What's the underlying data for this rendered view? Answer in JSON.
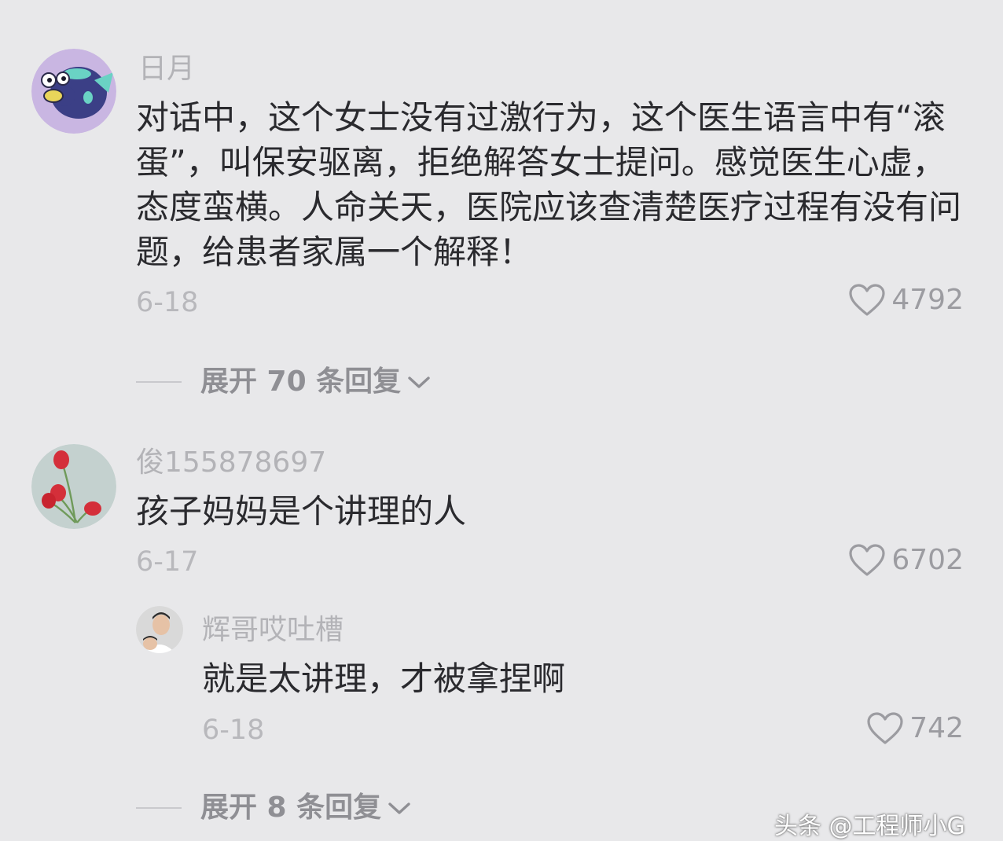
{
  "comments": [
    {
      "username": "日月",
      "text": "对话中，这个女士没有过激行为，这个医生语言中有“滚蛋”，叫保安驱离，拒绝解答女士提问。感觉医生心虚，态度蛮横。人命关天，医院应该查清楚医疗过程有没有问题，给患者家属一个解释！",
      "date": "6-18",
      "likes": "4792",
      "expand_label": "展开 70 条回复",
      "avatar_icon": "fish-cartoon-avatar"
    },
    {
      "username": "俊155878697",
      "text": "孩子妈妈是个讲理的人",
      "date": "6-17",
      "likes": "6702",
      "avatar_icon": "red-tulips-avatar",
      "reply": {
        "username": "辉哥哎吐槽",
        "text": "就是太讲理，才被拿捏啊",
        "date": "6-18",
        "likes": "742",
        "avatar_icon": "man-photo-avatar"
      },
      "expand_label": "展开 8 条回复"
    }
  ],
  "watermark": "头条 @工程师小G",
  "icons": {
    "like": "heart-outline-icon",
    "expand": "chevron-down-icon"
  },
  "colors": {
    "background": "#e8e8ea",
    "text": "#2a2a2e",
    "muted": "#b3b3b7"
  }
}
